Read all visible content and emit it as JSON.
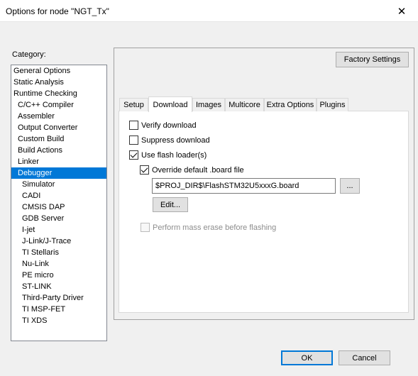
{
  "window": {
    "title": "Options for node \"NGT_Tx\"",
    "close_glyph": "✕"
  },
  "category": {
    "label": "Category:",
    "items": [
      {
        "label": "General Options",
        "level": 0,
        "selected": false
      },
      {
        "label": "Static Analysis",
        "level": 0,
        "selected": false
      },
      {
        "label": "Runtime Checking",
        "level": 0,
        "selected": false
      },
      {
        "label": "C/C++ Compiler",
        "level": 1,
        "selected": false
      },
      {
        "label": "Assembler",
        "level": 1,
        "selected": false
      },
      {
        "label": "Output Converter",
        "level": 1,
        "selected": false
      },
      {
        "label": "Custom Build",
        "level": 1,
        "selected": false
      },
      {
        "label": "Build Actions",
        "level": 1,
        "selected": false
      },
      {
        "label": "Linker",
        "level": 1,
        "selected": false
      },
      {
        "label": "Debugger",
        "level": 1,
        "selected": true
      },
      {
        "label": "Simulator",
        "level": 2,
        "selected": false
      },
      {
        "label": "CADI",
        "level": 2,
        "selected": false
      },
      {
        "label": "CMSIS DAP",
        "level": 2,
        "selected": false
      },
      {
        "label": "GDB Server",
        "level": 2,
        "selected": false
      },
      {
        "label": "I-jet",
        "level": 2,
        "selected": false
      },
      {
        "label": "J-Link/J-Trace",
        "level": 2,
        "selected": false
      },
      {
        "label": "TI Stellaris",
        "level": 2,
        "selected": false
      },
      {
        "label": "Nu-Link",
        "level": 2,
        "selected": false
      },
      {
        "label": "PE micro",
        "level": 2,
        "selected": false
      },
      {
        "label": "ST-LINK",
        "level": 2,
        "selected": false
      },
      {
        "label": "Third-Party Driver",
        "level": 2,
        "selected": false
      },
      {
        "label": "TI MSP-FET",
        "level": 2,
        "selected": false
      },
      {
        "label": "TI XDS",
        "level": 2,
        "selected": false
      }
    ]
  },
  "factory_settings_label": "Factory Settings",
  "tabs": [
    {
      "label": "Setup",
      "active": false
    },
    {
      "label": "Download",
      "active": true
    },
    {
      "label": "Images",
      "active": false
    },
    {
      "label": "Multicore",
      "active": false
    },
    {
      "label": "Extra Options",
      "active": false
    },
    {
      "label": "Plugins",
      "active": false
    }
  ],
  "download": {
    "verify_download": {
      "label": "Verify download",
      "checked": false
    },
    "suppress_download": {
      "label": "Suppress download",
      "checked": false
    },
    "use_flash_loader": {
      "label": "Use flash loader(s)",
      "checked": true
    },
    "override_board_file": {
      "label": "Override default .board file",
      "checked": true
    },
    "board_file_path": "$PROJ_DIR$\\FlashSTM32U5xxxG.board",
    "browse_label": "...",
    "edit_label": "Edit...",
    "mass_erase": {
      "label": "Perform mass erase before flashing",
      "checked": false,
      "disabled": true
    }
  },
  "buttons": {
    "ok": "OK",
    "cancel": "Cancel"
  },
  "colors": {
    "selection": "#0078d7",
    "default_button_border": "#0078d7"
  }
}
